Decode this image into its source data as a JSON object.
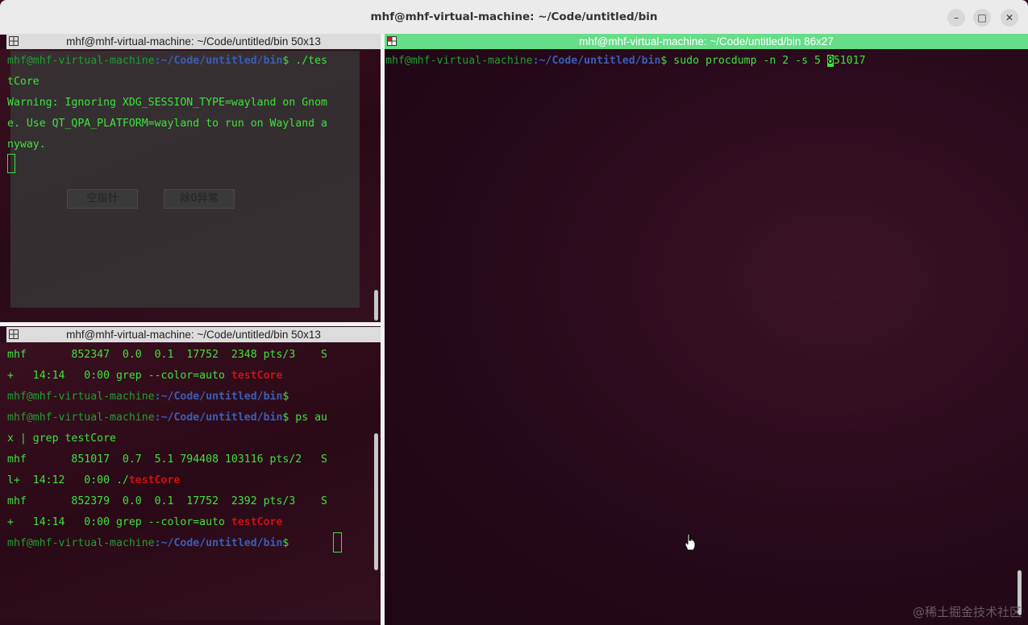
{
  "window": {
    "title": "mhf@mhf-virtual-machine: ~/Code/untitled/bin",
    "minimize_glyph": "–",
    "maximize_glyph": "□",
    "close_glyph": "✕"
  },
  "panes": {
    "top_left": {
      "header": "mhf@mhf-virtual-machine: ~/Code/untitled/bin 50x13",
      "lines": {
        "l1_prompt_user": "mhf@mhf-virtual-machine",
        "l1_prompt_path": ":~/Code/untitled/bin",
        "l1_cmd": "$ ./tes",
        "l2": "tCore",
        "l3": "Warning: Ignoring XDG_SESSION_TYPE=wayland on Gnom",
        "l4": "e. Use QT_QPA_PLATFORM=wayland to run on Wayland a",
        "l5": "nyway."
      },
      "qt_app": {
        "button_null_ptr": "空指针",
        "button_div_zero": "除0异常"
      }
    },
    "bottom_left": {
      "header": "mhf@mhf-virtual-machine: ~/Code/untitled/bin 50x13",
      "lines": {
        "l1": "mhf       852347  0.0  0.1  17752  2348 pts/3    S",
        "l2_pre": "+   14:14   0:00 grep --color=auto ",
        "l2_red": "testCore",
        "l3_user": "mhf@mhf-virtual-machine",
        "l3_path": ":~/Code/untitled/bin",
        "l3_dollar": "$",
        "l4_user": "mhf@mhf-virtual-machine",
        "l4_path": ":~/Code/untitled/bin",
        "l4_cmd": "$ ps au",
        "l5": "x | grep testCore",
        "l6": "mhf       851017  0.7  5.1 794408 103116 pts/2   S",
        "l7_pre": "l+  14:12   0:00 ./",
        "l7_red": "testCore",
        "l8": "mhf       852379  0.0  0.1  17752  2392 pts/3    S",
        "l9_pre": "+   14:14   0:00 grep --color=auto ",
        "l9_red": "testCore",
        "l10_user": "mhf@mhf-virtual-machine",
        "l10_path": ":~/Code/untitled/bin",
        "l10_dollar": "$ "
      }
    },
    "right": {
      "header": "mhf@mhf-virtual-machine: ~/Code/untitled/bin 86x27",
      "lines": {
        "l1_user": "mhf@mhf-virtual-machine",
        "l1_path": ":~/Code/untitled/bin",
        "l1_cmd": "$ sudo procdump -n 2 -s 5 ",
        "l1_cursor_char": "8",
        "l1_rest": "51017"
      }
    }
  },
  "watermark": "@稀土掘金技术社区",
  "colors": {
    "terminal_text": "#3ee23e",
    "prompt_path": "#3b5eb5",
    "match_highlight": "#cc1111",
    "active_pane_header": "#66dd88"
  }
}
